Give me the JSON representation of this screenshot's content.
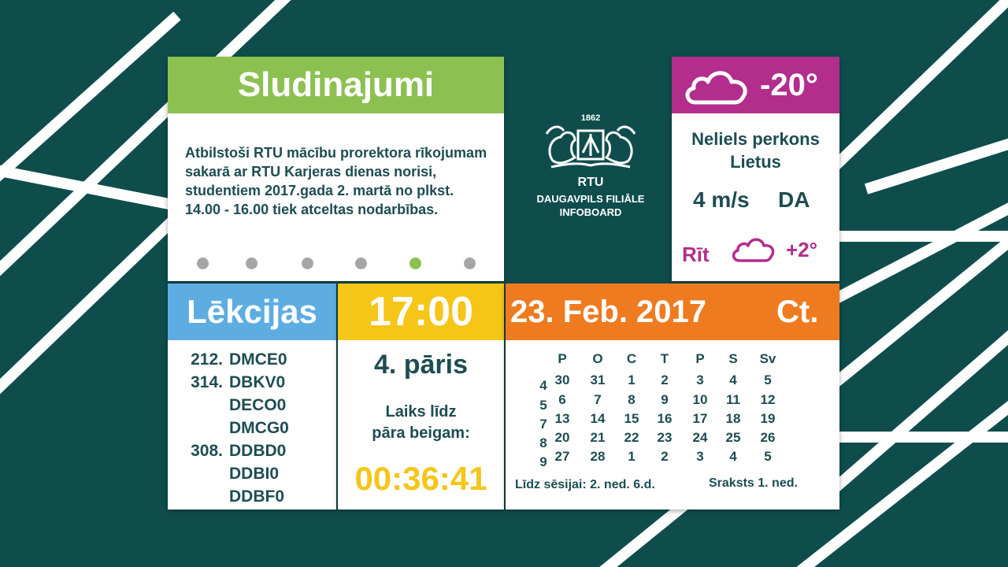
{
  "announcements": {
    "title": "Sludinajumi",
    "text": "Atbilstoši RTU mācību prorektora rīkojumam sakarā ar RTU Karjeras dienas norisi, studentiem 2017.gada 2. martā no plkst. 14.00 - 16.00 tiek atceltas nodarbības.",
    "slide_count": 6,
    "active_slide": 5,
    "accent_color": "#8cc152"
  },
  "logo": {
    "year": "1862",
    "name": "RTU",
    "line1": "DAUGAVPILS FILIĀLE",
    "line2": "INFOBOARD"
  },
  "weather": {
    "icon": "cloud-icon",
    "temperature": "-20°",
    "condition_line1": "Neliels perkons",
    "condition_line2": "Lietus",
    "wind_speed": "4 m/s",
    "wind_direction": "DA",
    "tomorrow_label": "Rīt",
    "tomorrow_icon": "cloud-icon",
    "tomorrow_temperature": "+2°",
    "accent_color": "#b32d8c"
  },
  "lectures": {
    "title": "Lēkcijas",
    "rows": [
      {
        "room": "212.",
        "group": "DMCE0"
      },
      {
        "room": "314.",
        "group": "DBKV0"
      },
      {
        "room": "",
        "group": "DECO0"
      },
      {
        "room": "",
        "group": "DMCG0"
      },
      {
        "room": "308.",
        "group": "DDBD0"
      },
      {
        "room": "",
        "group": "DDBI0"
      },
      {
        "room": "",
        "group": "DDBF0"
      }
    ]
  },
  "time": {
    "clock": "17:00",
    "pair": "4. pāris",
    "label_line1": "Laiks līdz",
    "label_line2": "pāra beigam:",
    "countdown": "00:36:41"
  },
  "calendar": {
    "date": "23. Feb. 2017",
    "weekday": "Ct.",
    "day_headers": [
      "P",
      "O",
      "C",
      "T",
      "P",
      "S",
      "Sv"
    ],
    "weeks": [
      {
        "num": "4",
        "days": [
          "30",
          "31",
          "1",
          "2",
          "3",
          "4",
          "5"
        ]
      },
      {
        "num": "5",
        "days": [
          "6",
          "7",
          "8",
          "9",
          "10",
          "11",
          "12"
        ]
      },
      {
        "num": "7",
        "days": [
          "13",
          "14",
          "15",
          "16",
          "17",
          "18",
          "19"
        ]
      },
      {
        "num": "8",
        "days": [
          "20",
          "21",
          "22",
          "23",
          "24",
          "25",
          "26"
        ]
      },
      {
        "num": "9",
        "days": [
          "27",
          "28",
          "1",
          "2",
          "3",
          "4",
          "5"
        ]
      }
    ],
    "until_session": "Līdz sēsijai: 2. ned. 6.d.",
    "registration": "Sraksts 1. ned."
  },
  "colors": {
    "background": "#0f4d4d",
    "lectures": "#5dade2",
    "time": "#f5c518",
    "calendar": "#ef7b21"
  }
}
